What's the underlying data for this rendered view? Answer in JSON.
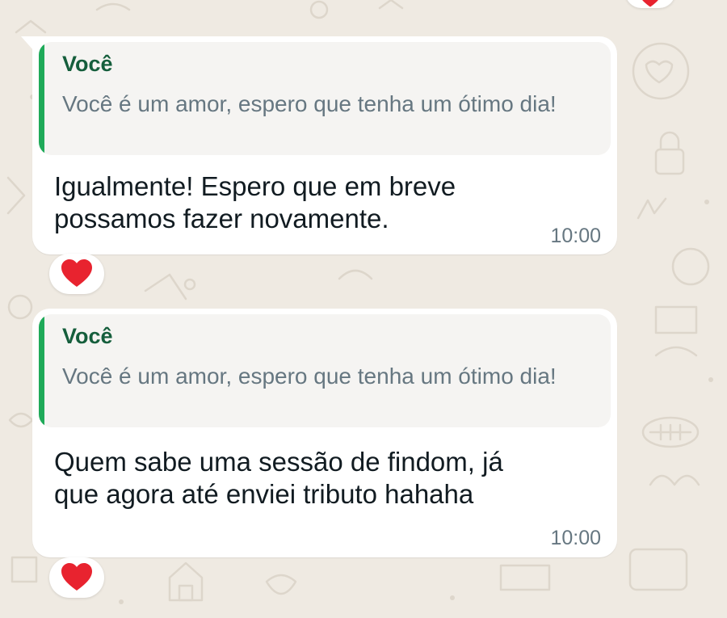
{
  "colors": {
    "wallpaper": "#efeae2",
    "bubble": "#ffffff",
    "quote_bg": "#f5f4f2",
    "quote_bar": "#1faa59",
    "quote_author": "#155e3c",
    "heart": "#e8232f"
  },
  "messages": [
    {
      "quote_author": "Você",
      "quote_text": "Você é um amor, espero que tenha um ótimo dia!",
      "text": "Igualmente! Espero que em breve possamos fazer novamente.",
      "time": "10:00",
      "reaction": "red-heart-icon"
    },
    {
      "quote_author": "Você",
      "quote_text": "Você é um amor, espero que tenha um ótimo dia!",
      "text": "Quem sabe uma sessão de findom, já que agora até enviei tributo hahaha",
      "time": "10:00",
      "reaction": "red-heart-icon"
    }
  ]
}
